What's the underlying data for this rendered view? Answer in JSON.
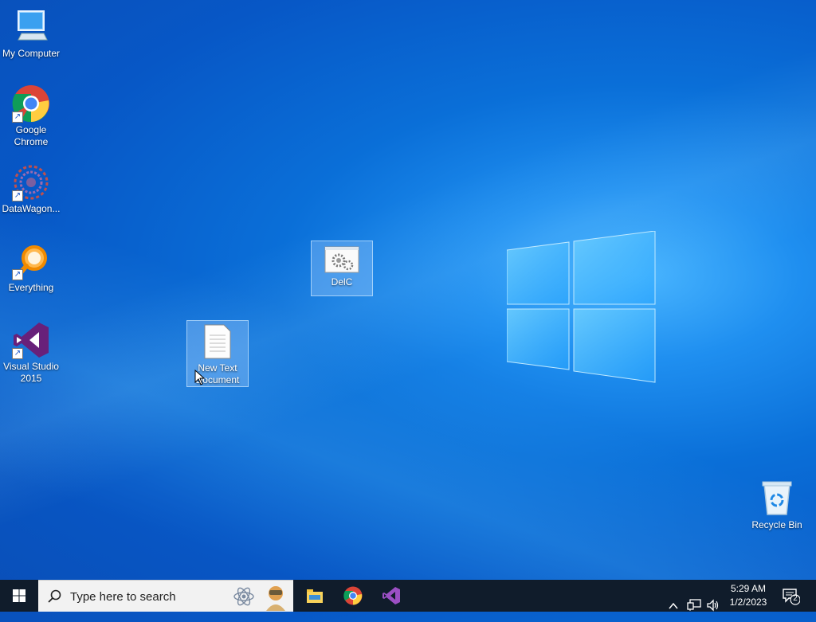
{
  "desktop": {
    "icons": [
      {
        "label": "My Computer",
        "icon": "computer-icon"
      },
      {
        "label": "Google Chrome",
        "icon": "chrome-icon"
      },
      {
        "label": "DataWagon...",
        "icon": "datawagon-icon"
      },
      {
        "label": "Everything",
        "icon": "everything-search-icon"
      },
      {
        "label": "Visual Studio 2015",
        "icon": "visual-studio-icon"
      },
      {
        "label": "DelC",
        "icon": "gear-window-icon"
      },
      {
        "label": "New Text Document",
        "icon": "text-document-icon"
      },
      {
        "label": "Recycle Bin",
        "icon": "recycle-bin-icon"
      }
    ]
  },
  "taskbar": {
    "search_placeholder": "Type here to search",
    "pinned": [
      "file-explorer-icon",
      "chrome-icon",
      "visual-studio-icon"
    ],
    "tray_icons": [
      "chevron-up-icon",
      "network-icon",
      "volume-icon"
    ],
    "time": "5:29 AM",
    "date": "1/2/2023",
    "notification_count": "2"
  },
  "colors": {
    "taskbar_bg": "#101c2b",
    "desktop_accent": "#0a6fd8"
  }
}
